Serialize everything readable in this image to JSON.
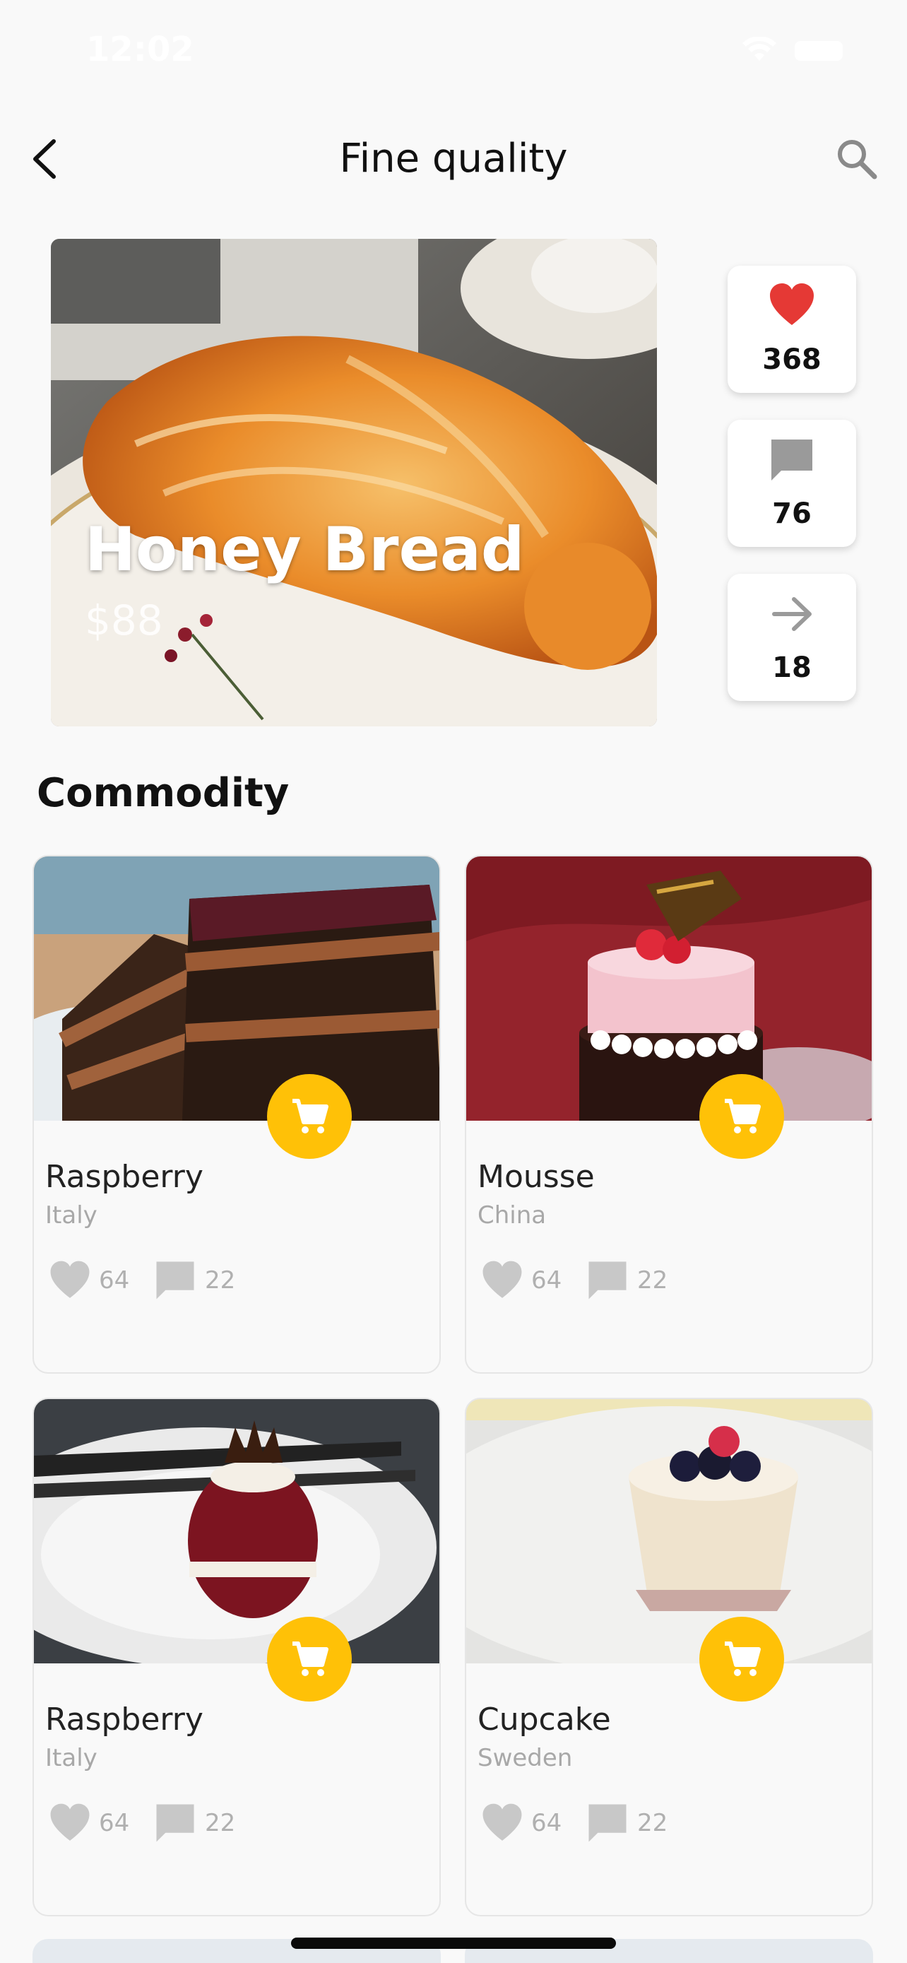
{
  "status_bar": {
    "time": "12:02"
  },
  "header": {
    "title": "Fine quality"
  },
  "featured": {
    "name": "Honey Bread",
    "price": "$88"
  },
  "stats": {
    "likes": "368",
    "comments": "76",
    "shares": "18"
  },
  "section": {
    "title": "Commodity"
  },
  "products": [
    {
      "name": "Raspberry",
      "origin": "Italy",
      "likes": "64",
      "comments": "22"
    },
    {
      "name": "Mousse",
      "origin": "China",
      "likes": "64",
      "comments": "22"
    },
    {
      "name": "Raspberry",
      "origin": "Italy",
      "likes": "64",
      "comments": "22"
    },
    {
      "name": "Cupcake",
      "origin": "Sweden",
      "likes": "64",
      "comments": "22"
    }
  ],
  "colors": {
    "accent": "#ffc107",
    "heart": "#e53935",
    "background": "#f9f9f9",
    "muted_icon": "#c8c8c8"
  },
  "icons": [
    "back-arrow-icon",
    "search-icon",
    "heart-icon",
    "comment-icon",
    "share-arrow-icon",
    "cart-icon"
  ]
}
